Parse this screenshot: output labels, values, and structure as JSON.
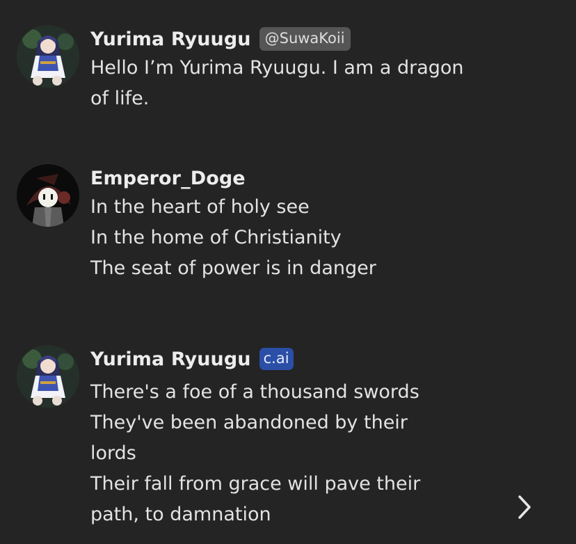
{
  "messages": [
    {
      "author": "Yurima Ryuugu",
      "badge": "@SuwaKoii",
      "lines": [
        "Hello I’m Yurima Ryuugu. I am a dragon",
        "of life."
      ]
    },
    {
      "author": "Emperor_Doge",
      "lines": [
        "In the heart of holy see",
        "In the home of Christianity",
        "The seat of power is in danger"
      ]
    },
    {
      "author": "Yurima Ryuugu",
      "badge": "c.ai",
      "lines": [
        "There's a foe of a thousand swords",
        "They've been abandoned by their",
        "lords",
        "Their fall from grace will pave their",
        "path, to damnation"
      ]
    }
  ],
  "icons": {
    "next": "chevron-right-icon"
  },
  "colors": {
    "background": "#242424",
    "cai_badge": "#2b4fa6",
    "handle_badge": "#555555"
  }
}
